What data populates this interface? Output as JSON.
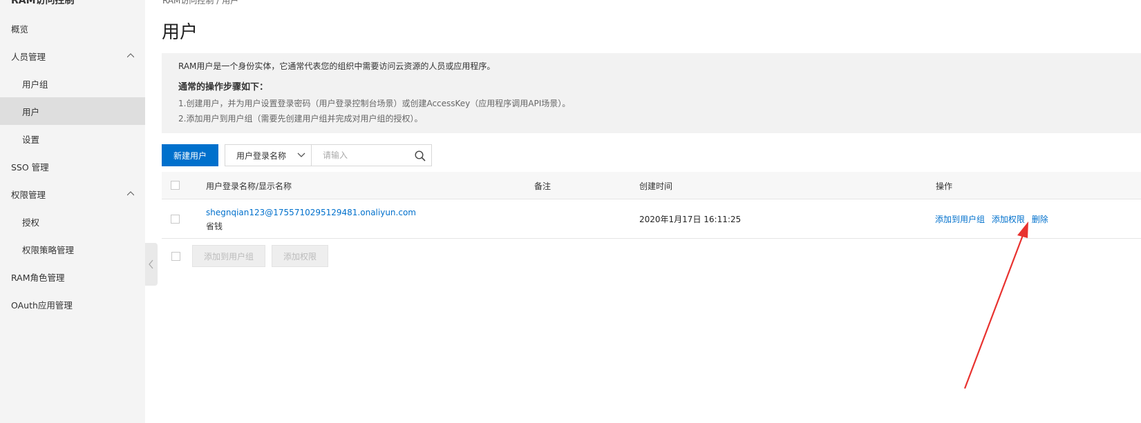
{
  "sidebar": {
    "cut_title": "RAM访问控制",
    "items": [
      {
        "label": "概览"
      },
      {
        "label": "人员管理"
      },
      {
        "label": "用户组"
      },
      {
        "label": "用户"
      },
      {
        "label": "设置"
      },
      {
        "label": "SSO 管理"
      },
      {
        "label": "权限管理"
      },
      {
        "label": "授权"
      },
      {
        "label": "权限策略管理"
      },
      {
        "label": "RAM角色管理"
      },
      {
        "label": "OAuth应用管理"
      }
    ]
  },
  "breadcrumb": "RAM访问控制 / 用户",
  "page_title": "用户",
  "info": {
    "line1": "RAM用户是一个身份实体，它通常代表您的组织中需要访问云资源的人员或应用程序。",
    "steps_title": "通常的操作步骤如下：",
    "step1": "1.创建用户，并为用户设置登录密码（用户登录控制台场景）或创建AccessKey（应用程序调用API场景）。",
    "step2": "2.添加用户到用户组（需要先创建用户组并完成对用户组的授权）。"
  },
  "toolbar": {
    "create_label": "新建用户",
    "filter_selected": "用户登录名称",
    "search_placeholder": "请输入"
  },
  "table": {
    "headers": {
      "name": "用户登录名称/显示名称",
      "note": "备注",
      "created": "创建时间",
      "actions": "操作"
    },
    "rows": [
      {
        "login": "shegnqian123@1755710295129481.onaliyun.com",
        "display": "省钱",
        "note": "",
        "created": "2020年1月17日 16:11:25",
        "action_add_group": "添加到用户组",
        "action_add_perm": "添加权限",
        "action_delete": "删除"
      }
    ]
  },
  "bulk": {
    "add_group": "添加到用户组",
    "add_perm": "添加权限"
  },
  "colors": {
    "primary": "#0070cc",
    "annotation_arrow": "#e8322f"
  }
}
